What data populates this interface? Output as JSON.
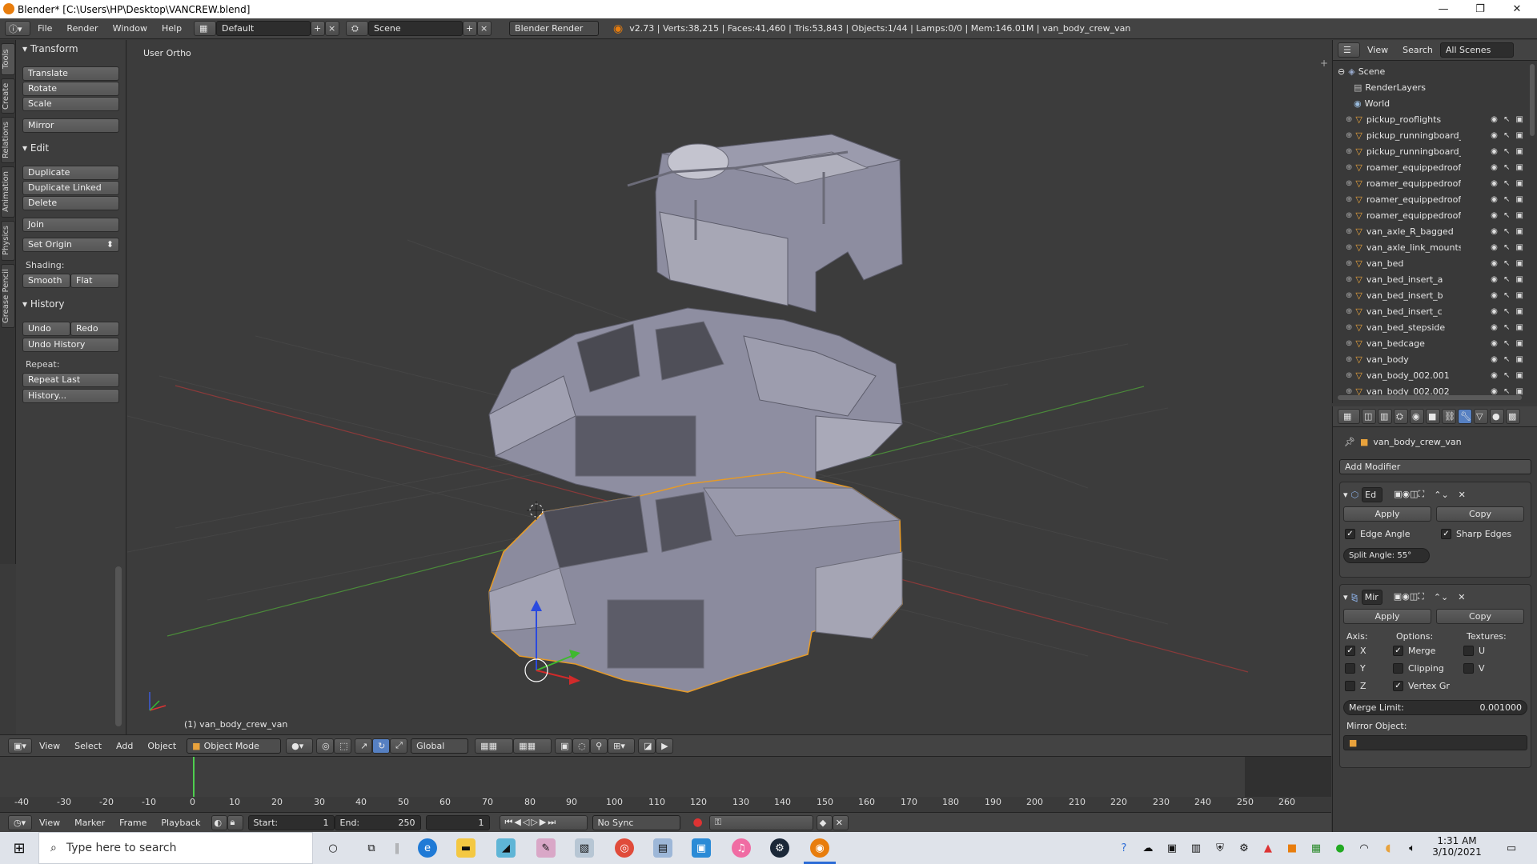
{
  "window": {
    "title": "Blender* [C:\\Users\\HP\\Desktop\\VANCREW.blend]",
    "minimize": "—",
    "maximize": "❐",
    "close": "✕"
  },
  "infobar": {
    "menus": [
      "File",
      "Render",
      "Window",
      "Help"
    ],
    "layout": "Default",
    "scene": "Scene",
    "engine": "Blender Render",
    "stats": "v2.73 | Verts:38,215 | Faces:41,460 | Tris:53,843 | Objects:1/44 | Lamps:0/0 | Mem:146.01M | van_body_crew_van"
  },
  "tabs": [
    "Tools",
    "Create",
    "Relations",
    "Animation",
    "Physics",
    "Grease Pencil"
  ],
  "toolshelf": {
    "transform_title": "Transform",
    "translate": "Translate",
    "rotate": "Rotate",
    "scale": "Scale",
    "mirror": "Mirror",
    "edit_title": "Edit",
    "duplicate": "Duplicate",
    "duplicate_linked": "Duplicate Linked",
    "delete": "Delete",
    "join": "Join",
    "set_origin": "Set Origin",
    "shading_label": "Shading:",
    "smooth": "Smooth",
    "flat": "Flat",
    "history_title": "History",
    "undo": "Undo",
    "redo": "Redo",
    "undo_history": "Undo History",
    "repeat_label": "Repeat:",
    "repeat_last": "Repeat Last",
    "history": "History..."
  },
  "viewport": {
    "view_label": "User Ortho",
    "object_label": "(1) van_body_crew_van"
  },
  "vp_header": {
    "view": "View",
    "select": "Select",
    "add": "Add",
    "object": "Object",
    "mode": "Object Mode",
    "orientation": "Global"
  },
  "timeline": {
    "ticks": [
      "-40",
      "-30",
      "-20",
      "-10",
      "0",
      "10",
      "20",
      "30",
      "40",
      "50",
      "60",
      "70",
      "80",
      "90",
      "100",
      "110",
      "120",
      "130",
      "140",
      "150",
      "160",
      "170",
      "180",
      "190",
      "200",
      "210",
      "220",
      "230",
      "240",
      "250",
      "260"
    ],
    "footer": {
      "view": "View",
      "marker": "Marker",
      "frame": "Frame",
      "playback": "Playback",
      "start_label": "Start:",
      "start": "1",
      "end_label": "End:",
      "end": "250",
      "current": "1",
      "sync": "No Sync"
    }
  },
  "outliner": {
    "view": "View",
    "search": "Search",
    "filter": "All Scenes",
    "scene": "Scene",
    "renderlayers": "RenderLayers",
    "world": "World",
    "items": [
      "pickup_rooflights",
      "pickup_runningboard_L",
      "pickup_runningboard_L",
      "roamer_equippedroofrac",
      "roamer_equippedroofrac",
      "roamer_equippedroofrac",
      "roamer_equippedroofrac",
      "van_axle_R_bagged",
      "van_axle_link_mounts",
      "van_bed",
      "van_bed_insert_a",
      "van_bed_insert_b",
      "van_bed_insert_c",
      "van_bed_stepside",
      "van_bedcage",
      "van_body",
      "van_body_002.001",
      "van_body_002.002"
    ]
  },
  "properties": {
    "object_name": "van_body_crew_van",
    "add_modifier": "Add Modifier",
    "mod1": {
      "name": "Ed",
      "apply": "Apply",
      "copy": "Copy",
      "edge_angle": "Edge Angle",
      "sharp_edges": "Sharp Edges",
      "split_angle": "Split Angle: 55°"
    },
    "mod2": {
      "name": "Mir",
      "apply": "Apply",
      "copy": "Copy",
      "axis": "Axis:",
      "options": "Options:",
      "textures": "Textures:",
      "x": "X",
      "y": "Y",
      "z": "Z",
      "merge": "Merge",
      "clipping": "Clipping",
      "vertex_gr": "Vertex Gr",
      "u": "U",
      "v": "V",
      "merge_limit_label": "Merge Limit:",
      "merge_limit": "0.001000",
      "mirror_object": "Mirror Object:"
    }
  },
  "taskbar": {
    "search_placeholder": "Type here to search",
    "time": "1:31 AM",
    "date": "3/10/2021"
  }
}
